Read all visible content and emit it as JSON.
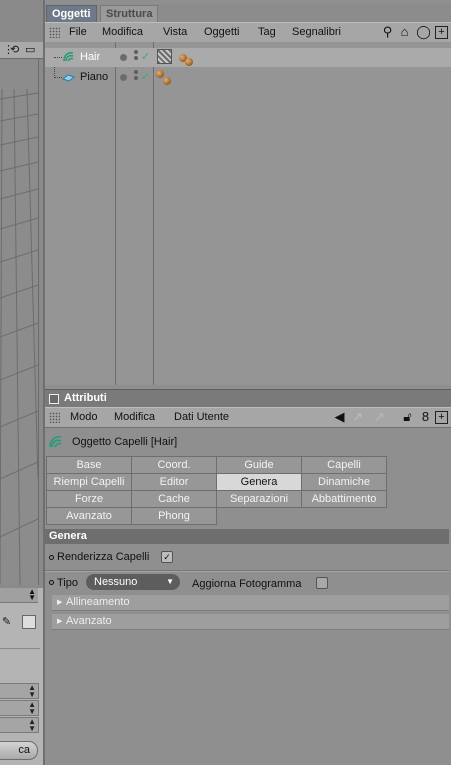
{
  "object_manager": {
    "tabs": [
      "Oggetti",
      "Struttura"
    ],
    "menu": [
      "File",
      "Modifica",
      "Vista",
      "Oggetti",
      "Tag",
      "Segnalibri"
    ],
    "toolbar_icons": [
      "search-icon",
      "home-icon",
      "layer-icon",
      "new-panel-icon"
    ],
    "objects": [
      {
        "name": "Hair",
        "icon": "hair-icon",
        "selected": true
      },
      {
        "name": "Piano",
        "icon": "plane-icon",
        "selected": false
      }
    ]
  },
  "attributes": {
    "title": "Attributi",
    "menu": [
      "Modo",
      "Modifica",
      "Dati Utente"
    ],
    "object_title": "Oggetto Capelli [Hair]",
    "tabs": [
      [
        "Base",
        "Coord.",
        "Guide",
        "Capelli"
      ],
      [
        "Riempi Capelli",
        "Editor",
        "Genera",
        "Dinamiche"
      ],
      [
        "Forze",
        "Cache",
        "Separazioni",
        "Abbattimento"
      ],
      [
        "Avanzato",
        "Phong"
      ]
    ],
    "active_tab": "Genera",
    "section": "Genera",
    "render_label": "Renderizza Capelli",
    "render_checked": true,
    "tipo_label": "Tipo",
    "tipo_value": "Nessuno",
    "aggiorna_label": "Aggiorna Fotogramma",
    "aggiorna_checked": false,
    "groups": [
      "Allineamento",
      "Avanzato"
    ]
  },
  "left_panel": {
    "button_label": "ca"
  }
}
